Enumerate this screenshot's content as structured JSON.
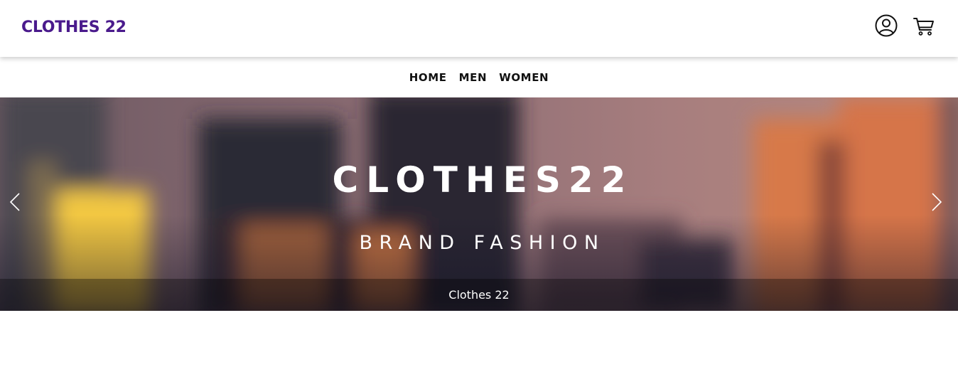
{
  "header": {
    "logo": "CLOTHES 22",
    "icons": {
      "account": "user-circle-icon",
      "cart": "shopping-cart-icon"
    },
    "brand_color": "#4a1a8c"
  },
  "nav": {
    "items": [
      {
        "label": "HOME"
      },
      {
        "label": "MEN"
      },
      {
        "label": "WOMEN"
      }
    ]
  },
  "carousel": {
    "title": "CLOTHES22",
    "subtitle": "BRAND FASHION",
    "caption": "Clothes 22",
    "prev_icon": "chevron-left-icon",
    "next_icon": "chevron-right-icon"
  }
}
